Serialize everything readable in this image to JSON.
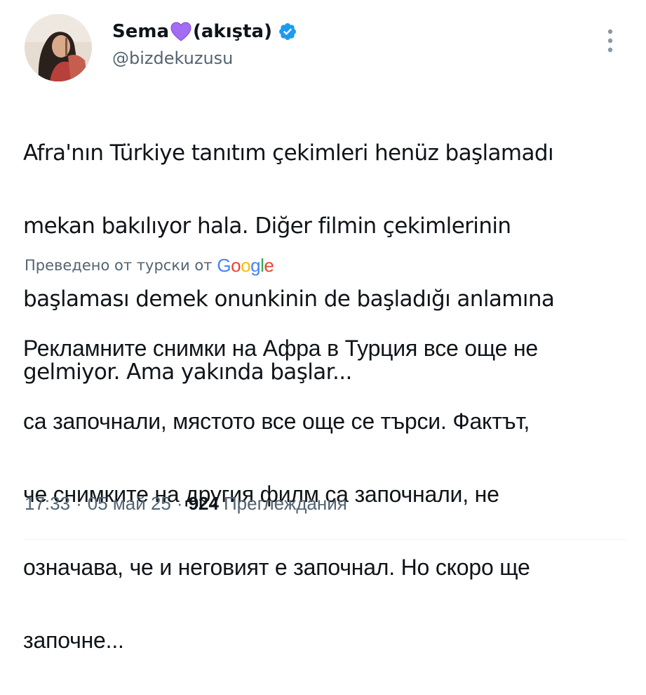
{
  "author": {
    "name_prefix": "Sema",
    "name_suffix": "(akışta)",
    "handle": "@bizdekuzusu",
    "verified": true
  },
  "tweet": {
    "original_lines": [
      "Afra'nın Türkiye tanıtım çekimleri henüz başlamadı",
      "mekan bakılıyor hala. Diğer filmin çekimlerinin",
      "başlaması demek onunkinin de başladığı anlamına",
      "gelmiyor. Ama yakında başlar..."
    ],
    "translated_by_label": "Преведено от турски от",
    "translator_brand": "Google",
    "translation_lines": [
      "Рекламните снимки на Афра в Турция все още не",
      "са започнали, мястото все още се търси. Фактът,",
      "че снимките на другия филм са започнали, не",
      "означава, че и неговият е започнал. Но скоро ще",
      "започне..."
    ]
  },
  "meta": {
    "time": "17:33",
    "separator": "·",
    "date": "05 май 25",
    "views_count": "924",
    "views_label": "Преглеждания"
  },
  "colors": {
    "text": "#0f1419",
    "secondary": "#536471",
    "verified_blue": "#1d9bf0",
    "heart_purple": "#a46bf3",
    "divider": "#eff3f4",
    "google_blue": "#4285f4",
    "google_red": "#ea4335",
    "google_yellow": "#fbbc05",
    "google_green": "#34a853"
  },
  "icons": {
    "heart": "purple-heart-icon",
    "verified": "verified-badge-icon",
    "more": "more-vertical-icon"
  }
}
